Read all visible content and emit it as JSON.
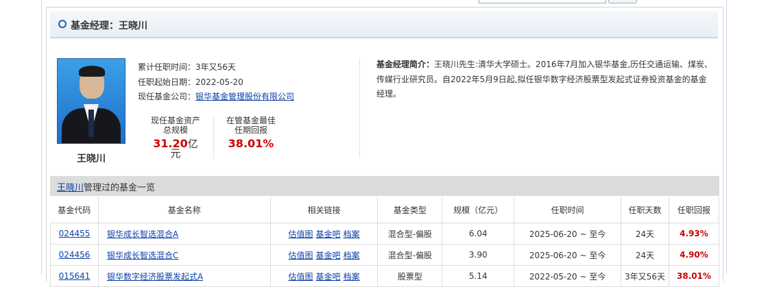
{
  "header": {
    "title": "基金经理：王晓川"
  },
  "manager": {
    "name": "王晓川",
    "tenure_label": "累计任职时间：",
    "tenure_value": "3年又56天",
    "start_label": "任职起始日期：",
    "start_value": "2022-05-20",
    "company_label": "现任基金公司：",
    "company_value": "银华基金管理股份有限公司",
    "stat1_label_line1": "现任基金资产",
    "stat1_label_line2": "总规模",
    "stat1_value": "31.20",
    "stat1_unit": "亿元",
    "stat2_label_line1": "在管基金最佳",
    "stat2_label_line2": "任期回报",
    "stat2_value": "38.01%",
    "intro_label": "基金经理简介：",
    "intro_text": "王晓川先生:清华大学硕士。2016年7月加入银华基金,历任交通运输、煤炭、传媒行业研究员。自2022年5月9日起,拟任银华数字经济股票型发起式证券投资基金的基金经理。"
  },
  "fund_list": {
    "title_link": "王晓川",
    "title_suffix": "管理过的基金一览",
    "columns": [
      "基金代码",
      "基金名称",
      "相关链接",
      "基金类型",
      "规模（亿元）",
      "任职时间",
      "任职天数",
      "任职回报"
    ],
    "link_labels": [
      "估值图",
      "基金吧",
      "档案"
    ],
    "rows": [
      {
        "code": "024455",
        "name": "银华成长智选混合A",
        "type": "混合型-偏股",
        "size": "6.04",
        "period": "2025-06-20 ~ 至今",
        "days": "24天",
        "ret": "4.93%"
      },
      {
        "code": "024456",
        "name": "银华成长智选混合C",
        "type": "混合型-偏股",
        "size": "3.90",
        "period": "2025-06-20 ~ 至今",
        "days": "24天",
        "ret": "4.90%"
      },
      {
        "code": "015641",
        "name": "银华数字经济股票发起式A",
        "type": "股票型",
        "size": "5.14",
        "period": "2022-05-20 ~ 至今",
        "days": "3年又56天",
        "ret": "38.01%"
      }
    ]
  },
  "colors": {
    "accent_blue": "#1f5ea8",
    "link_blue": "#0b3ea8",
    "return_red": "#cc0000"
  }
}
